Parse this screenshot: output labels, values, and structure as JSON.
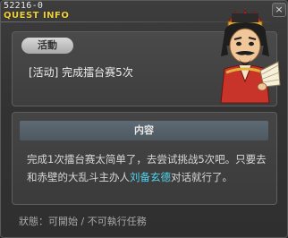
{
  "window": {
    "id_label": "52216-0",
    "title": "QUEST INFO",
    "close_label": "×"
  },
  "summary": {
    "category": "活動",
    "quest_title": "[活动] 完成擂台赛5次"
  },
  "portrait": {
    "icon": "npc-general-portrait"
  },
  "detail": {
    "header": "内容",
    "text_before": "完成1次擂台赛太简单了，去尝试挑战5次吧。只要去和赤壁的大乱斗主办人",
    "npc_name": "刘备玄德",
    "text_after": "对话就行了。"
  },
  "status": {
    "text": "狀態：可開始 / 不可執行任務"
  },
  "colors": {
    "title": "#f0d23a",
    "npc_link": "#4fd6f0",
    "header_bar": "#56616a"
  }
}
